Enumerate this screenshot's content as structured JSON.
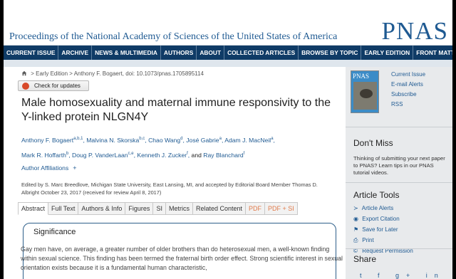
{
  "header": {
    "journal": "Proceedings of the National Academy of Sciences of the United States of America",
    "logo": "PNAS"
  },
  "nav": [
    {
      "label": "CURRENT ISSUE"
    },
    {
      "label": "ARCHIVE"
    },
    {
      "label": "NEWS & MULTIMEDIA"
    },
    {
      "label": "AUTHORS"
    },
    {
      "label": "ABOUT"
    },
    {
      "label": "COLLECTED ARTICLES"
    },
    {
      "label": "BROWSE BY TOPIC"
    },
    {
      "label": "EARLY EDITION"
    },
    {
      "label": "FRONT MATTER"
    }
  ],
  "breadcrumb": "> Early Edition > Anthony F. Bogaert, doi: 10.1073/pnas.1705895114",
  "check_button": "Check for updates",
  "article": {
    "title": "Male homosexuality and maternal immune responsivity to the Y-linked protein NLGN4Y",
    "authors": [
      {
        "name": "Anthony F. Bogaert",
        "sup": "a,b,1"
      },
      {
        "name": "Malvina N. Skorska",
        "sup": "b,c"
      },
      {
        "name": "Chao Wang",
        "sup": "d"
      },
      {
        "name": "José Gabrie",
        "sup": "a"
      },
      {
        "name": "Adam J. MacNeil",
        "sup": "a"
      },
      {
        "name": "Mark R. Hoffarth",
        "sup": "b"
      },
      {
        "name": "Doug P. VanderLaan",
        "sup": "c,e"
      },
      {
        "name": "Kenneth J. Zucker",
        "sup": "f"
      },
      {
        "name": "Ray Blanchard",
        "sup": "f"
      }
    ],
    "and_word": "and",
    "affiliations": "Author Affiliations",
    "edited": "Edited by S. Marc Breedlove, Michigan State University, East Lansing, MI, and accepted by Editorial Board Member Thomas D. Albright October 23, 2017 (received for review April 8, 2017)"
  },
  "tabs": [
    {
      "label": "Abstract",
      "active": true
    },
    {
      "label": "Full Text"
    },
    {
      "label": "Authors & Info"
    },
    {
      "label": "Figures"
    },
    {
      "label": "SI"
    },
    {
      "label": "Metrics"
    },
    {
      "label": "Related Content"
    },
    {
      "label": "PDF",
      "pdf": true
    },
    {
      "label": "PDF + SI",
      "pdf": true
    }
  ],
  "significance": {
    "heading": "Significance",
    "text": "Gay men have, on average, a greater number of older brothers than do heterosexual men, a well-known finding within sexual science. This finding has been termed the fraternal birth order effect. Strong scientific interest in sexual orientation exists because it is a fundamental human characteristic,"
  },
  "sidebar": {
    "cover_label": "PNAS",
    "links": [
      "Current Issue",
      "E-mail Alerts",
      "Subscribe",
      "RSS"
    ],
    "dont_miss_title": "Don't Miss",
    "dont_miss_text": "Thinking of submitting your next paper to PNAS? Learn tips in our PNAS tutorial videos.",
    "tools_title": "Article Tools",
    "tools": [
      {
        "label": "Article Alerts",
        "icon": "rss-icon"
      },
      {
        "label": "Export Citation",
        "icon": "globe-icon"
      },
      {
        "label": "Save for Later",
        "icon": "bookmark-icon"
      },
      {
        "label": "Print",
        "icon": "print-icon"
      },
      {
        "label": "Request Permission",
        "icon": "copyright-icon"
      }
    ],
    "share_title": "Share",
    "share_icons": "t f g+ in"
  }
}
